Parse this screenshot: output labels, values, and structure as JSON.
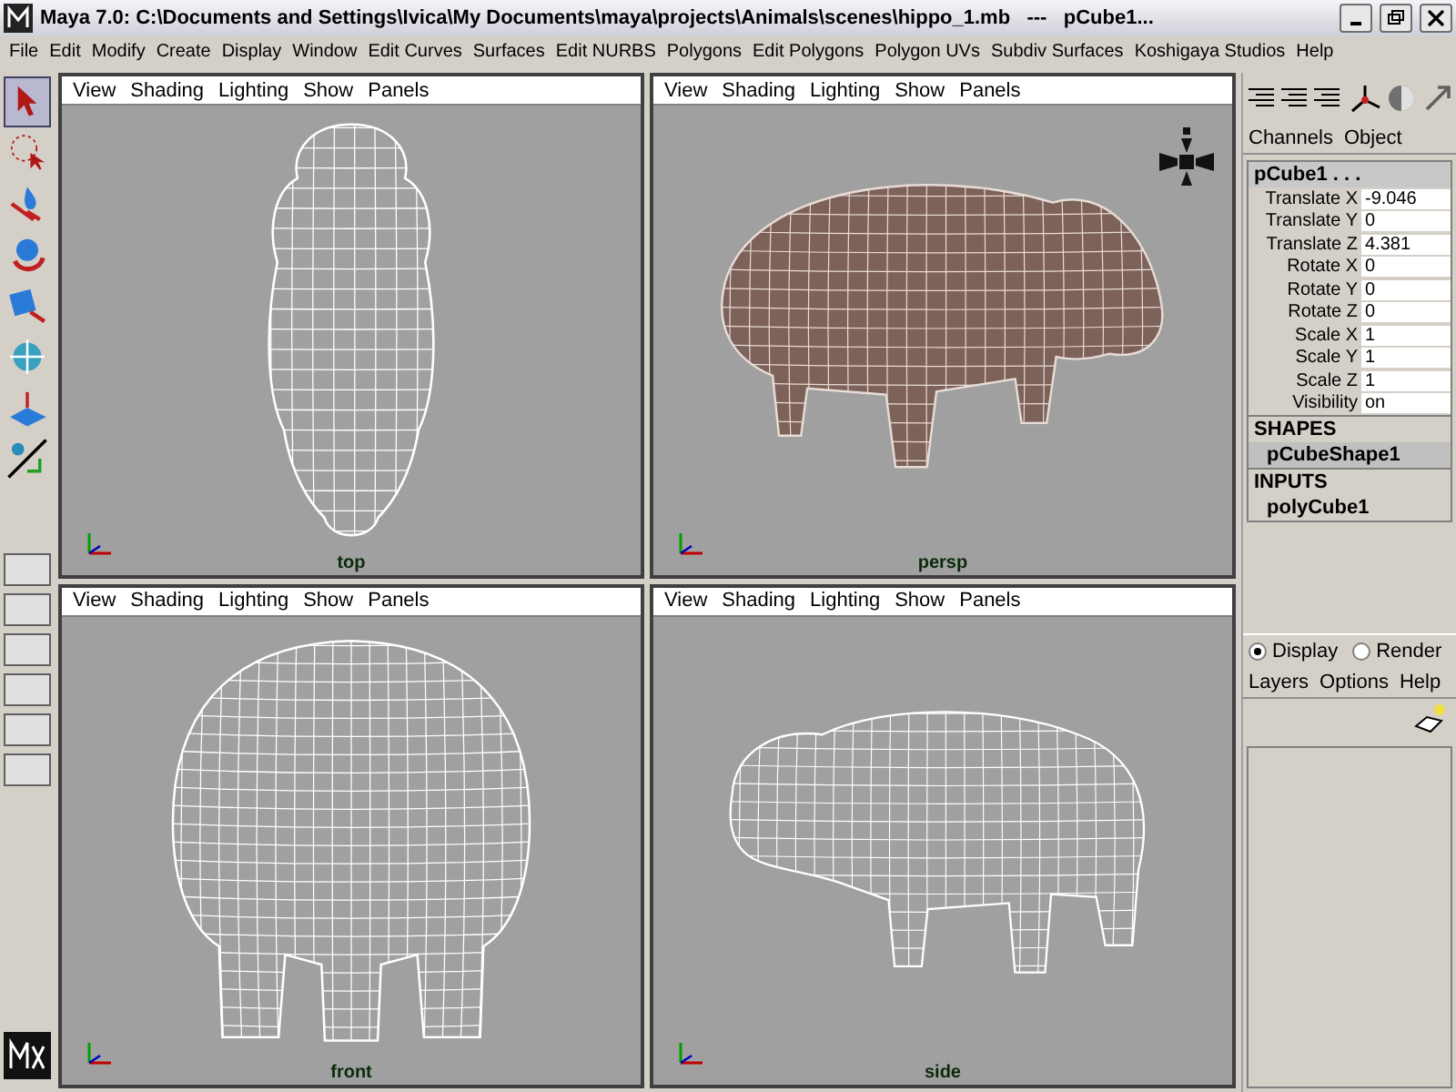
{
  "window": {
    "title": "Maya 7.0: C:\\Documents and Settings\\Ivica\\My Documents\\maya\\projects\\Animals\\scenes\\hippo_1.mb   ---   pCube1..."
  },
  "menu": [
    "File",
    "Edit",
    "Modify",
    "Create",
    "Display",
    "Window",
    "Edit Curves",
    "Surfaces",
    "Edit NURBS",
    "Polygons",
    "Edit Polygons",
    "Polygon UVs",
    "Subdiv Surfaces",
    "Koshigaya Studios",
    "Help"
  ],
  "tools": [
    {
      "kind": "select",
      "selected": true
    },
    {
      "kind": "lasso",
      "selected": false
    },
    {
      "kind": "move",
      "selected": false
    },
    {
      "kind": "rotate",
      "selected": false
    },
    {
      "kind": "scale",
      "selected": false
    },
    {
      "kind": "manip",
      "selected": false
    },
    {
      "kind": "soft",
      "selected": false
    },
    {
      "kind": "last",
      "selected": false
    }
  ],
  "viewports": [
    {
      "label": "top",
      "kind": "overhead",
      "menu": [
        "View",
        "Shading",
        "Lighting",
        "Show",
        "Panels"
      ]
    },
    {
      "label": "persp",
      "kind": "shaded",
      "menu": [
        "View",
        "Shading",
        "Lighting",
        "Show",
        "Panels"
      ]
    },
    {
      "label": "front",
      "kind": "frontal",
      "menu": [
        "View",
        "Shading",
        "Lighting",
        "Show",
        "Panels"
      ]
    },
    {
      "label": "side",
      "kind": "profile",
      "menu": [
        "View",
        "Shading",
        "Lighting",
        "Show",
        "Panels"
      ]
    }
  ],
  "channel_box": {
    "tabs": [
      "Channels",
      "Object"
    ],
    "node": "pCube1 . . .",
    "attributes": [
      {
        "name": "Translate X",
        "value": "-9.046"
      },
      {
        "name": "Translate Y",
        "value": "0"
      },
      {
        "name": "Translate Z",
        "value": "4.381"
      },
      {
        "name": "Rotate X",
        "value": "0"
      },
      {
        "name": "Rotate Y",
        "value": "0"
      },
      {
        "name": "Rotate Z",
        "value": "0"
      },
      {
        "name": "Scale X",
        "value": "1"
      },
      {
        "name": "Scale Y",
        "value": "1"
      },
      {
        "name": "Scale Z",
        "value": "1"
      },
      {
        "name": "Visibility",
        "value": "on"
      }
    ],
    "shapes_heading": "SHAPES",
    "shapes": [
      {
        "name": "pCubeShape1",
        "selected": true
      }
    ],
    "inputs_heading": "INPUTS",
    "inputs": [
      {
        "name": "polyCube1"
      }
    ]
  },
  "layer_editor": {
    "modes": [
      {
        "label": "Display",
        "selected": true
      },
      {
        "label": "Render",
        "selected": false
      }
    ],
    "menu": [
      "Layers",
      "Options",
      "Help"
    ]
  }
}
